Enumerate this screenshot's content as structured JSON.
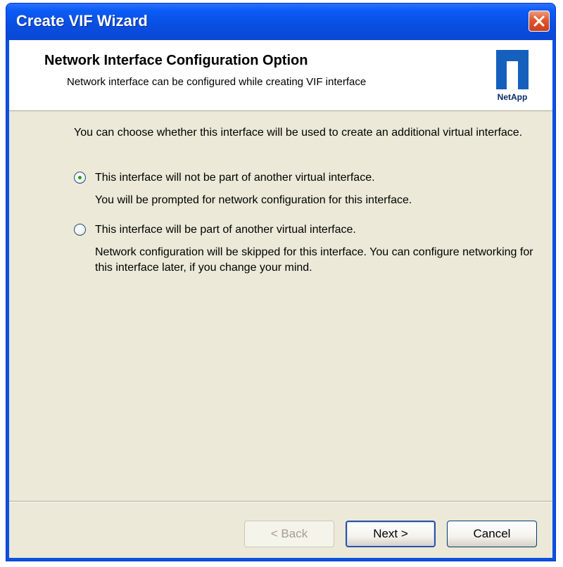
{
  "window": {
    "title": "Create VIF Wizard"
  },
  "header": {
    "title": "Network Interface Configuration Option",
    "subtitle": "Network interface can be configured while creating VIF interface",
    "logo_text": "NetApp"
  },
  "content": {
    "intro": "You can choose whether this interface will be used to create an additional virtual interface.",
    "options": [
      {
        "label": "This interface will not be part of another virtual interface.",
        "description": "You will be prompted for network configuration for this interface.",
        "selected": true
      },
      {
        "label": "This interface will be part of another virtual interface.",
        "description": "Network configuration will be skipped for this interface. You can configure networking for this interface later, if you change your mind.",
        "selected": false
      }
    ]
  },
  "buttons": {
    "back": "< Back",
    "next": "Next >",
    "cancel": "Cancel"
  },
  "colors": {
    "titlebar": "#0a4ee0",
    "client": "#ece9d8",
    "close": "#e2562e",
    "logo": "#1560bd"
  }
}
